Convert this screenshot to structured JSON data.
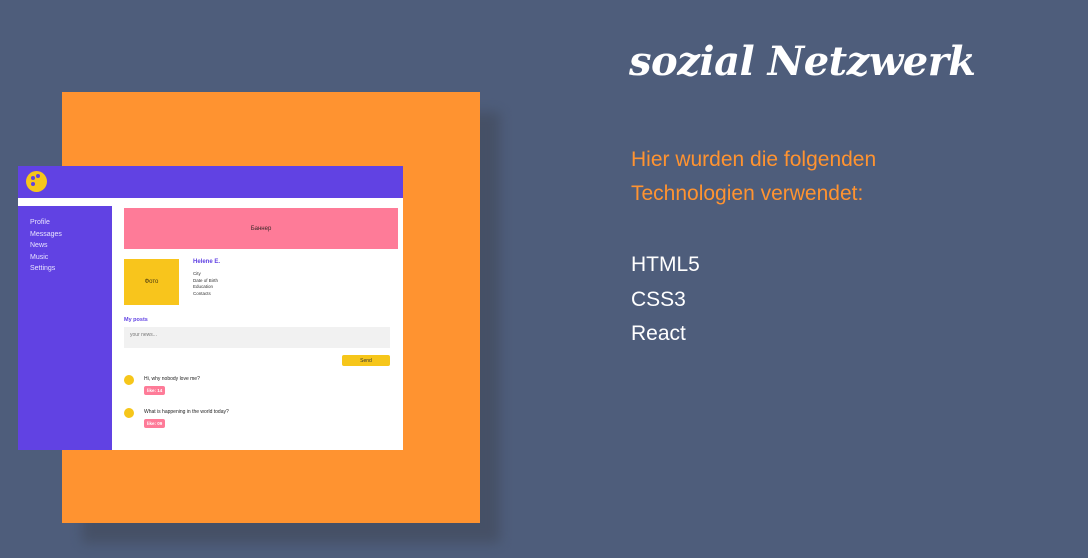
{
  "project": {
    "title": "sozial Netzwerk",
    "intro_line1": "Hier wurden die folgenden",
    "intro_line2": "Technologien verwendet:",
    "technologies": [
      "HTML5",
      "CSS3",
      "React"
    ]
  },
  "mockup": {
    "sidebar": [
      "Profile",
      "Messages",
      "News",
      "Music",
      "Settings"
    ],
    "banner_label": "Баннер",
    "avatar_label": "Фото",
    "profile": {
      "name": "Helene E.",
      "fields": [
        "City",
        "Date of Birth",
        "Education",
        "Contacts"
      ]
    },
    "posts_title": "My posts",
    "post_input_placeholder": "your news...",
    "send_label": "Send",
    "posts": [
      {
        "text": "Hi, why nobody love me?",
        "likes": "like: 14"
      },
      {
        "text": "What is happening in the world today?",
        "likes": "like: 09"
      }
    ]
  },
  "colors": {
    "background": "#4e5d7b",
    "accent_orange": "#ff9330",
    "mock_purple": "#6142e3",
    "mock_pink": "#fe7b98",
    "mock_yellow": "#f6c61a"
  }
}
